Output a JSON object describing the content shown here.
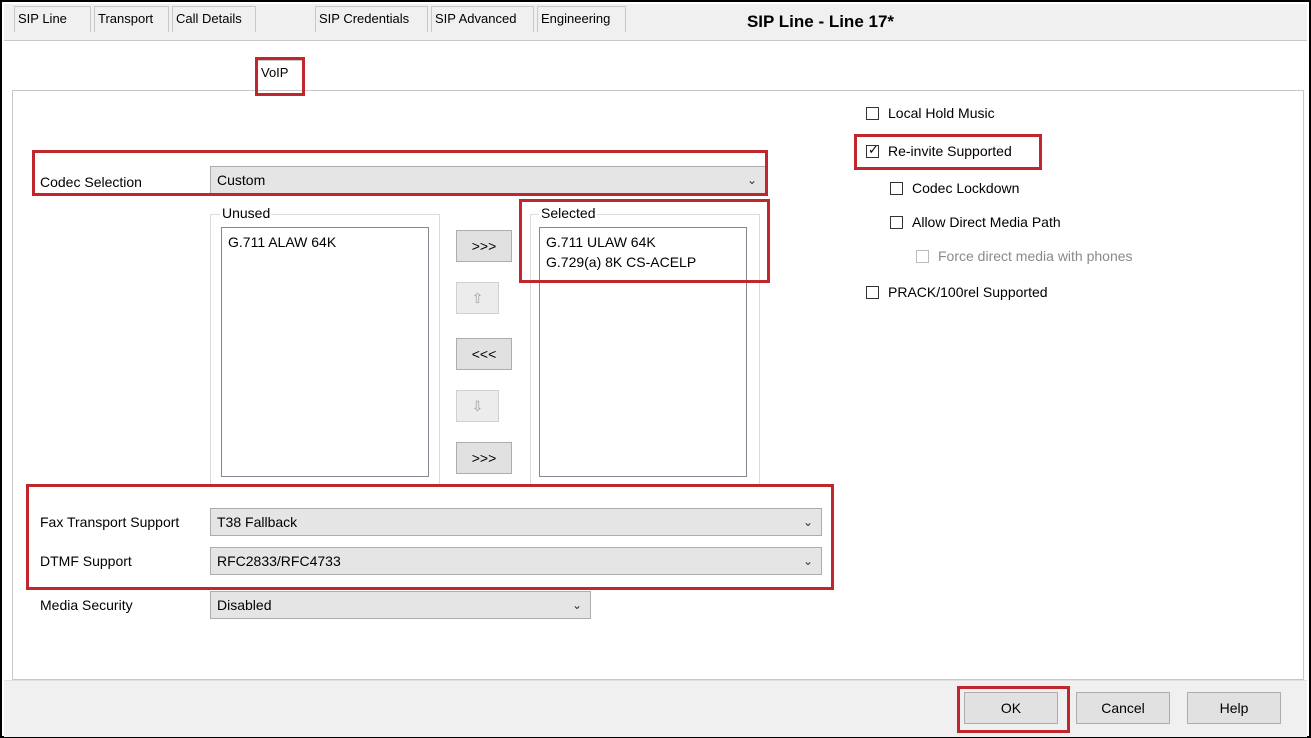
{
  "window": {
    "title": "SIP Line - Line 17*"
  },
  "tabs": [
    {
      "label": "SIP Line"
    },
    {
      "label": "Transport"
    },
    {
      "label": "Call Details"
    },
    {
      "label": "VoIP"
    },
    {
      "label": "SIP Credentials"
    },
    {
      "label": "SIP Advanced"
    },
    {
      "label": "Engineering"
    }
  ],
  "voip": {
    "codec_selection": {
      "label": "Codec Selection",
      "value": "Custom"
    },
    "unused": {
      "title": "Unused",
      "items": [
        "G.711 ALAW 64K"
      ]
    },
    "selected": {
      "title": "Selected",
      "items": [
        "G.711 ULAW 64K",
        "G.729(a) 8K CS-ACELP"
      ]
    },
    "buttons": {
      "add": ">>>",
      "up": "⇧",
      "remove": "<<<",
      "down": "⇩",
      "add_all": ">>>"
    },
    "fax": {
      "label": "Fax Transport Support",
      "value": "T38 Fallback"
    },
    "dtmf": {
      "label": "DTMF Support",
      "value": "RFC2833/RFC4733"
    },
    "media_security": {
      "label": "Media Security",
      "value": "Disabled"
    },
    "options": {
      "local_hold_music": {
        "label": "Local Hold Music",
        "checked": false
      },
      "reinvite_supported": {
        "label": "Re-invite Supported",
        "checked": true
      },
      "codec_lockdown": {
        "label": "Codec Lockdown",
        "checked": false
      },
      "allow_direct_media": {
        "label": "Allow Direct Media Path",
        "checked": false
      },
      "force_direct_media": {
        "label": "Force direct media with phones",
        "checked": false,
        "disabled": true
      },
      "prack": {
        "label": "PRACK/100rel Supported",
        "checked": false
      }
    }
  },
  "footer": {
    "ok": "OK",
    "cancel": "Cancel",
    "help": "Help"
  },
  "colors": {
    "highlight": "#c0272d",
    "window_bg": "#f0f0f0"
  }
}
